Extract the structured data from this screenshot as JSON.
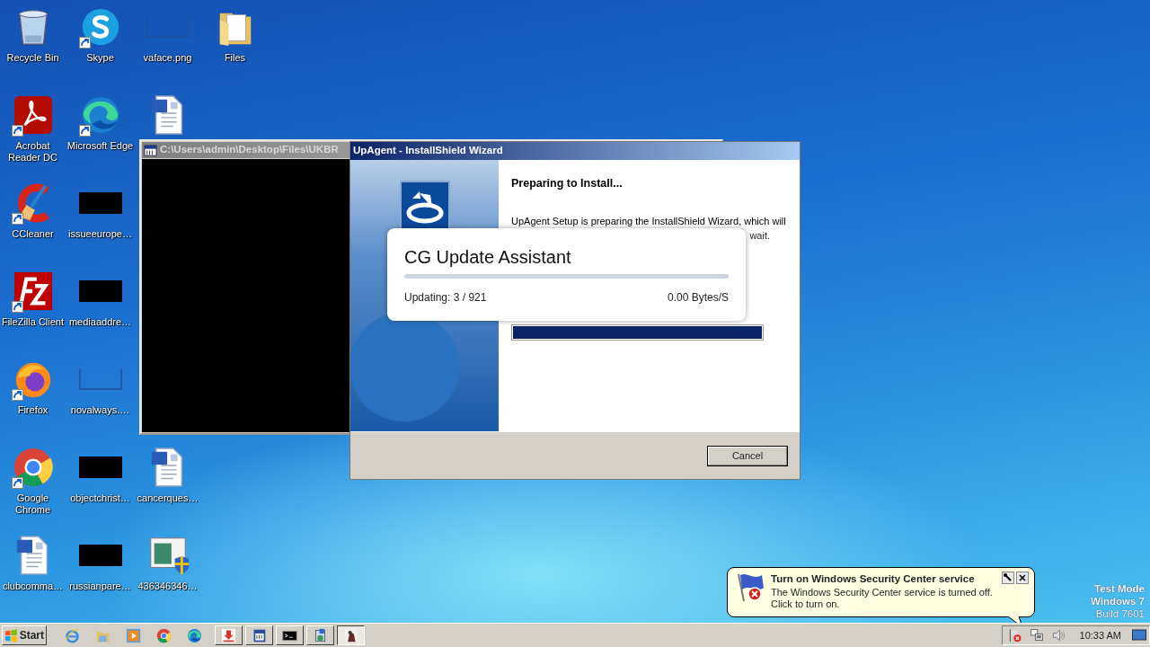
{
  "desktop_icons": [
    {
      "label": "Recycle Bin",
      "kind": "recycle-bin",
      "shortcut": false
    },
    {
      "label": "Acrobat Reader DC",
      "kind": "pdf",
      "shortcut": true
    },
    {
      "label": "CCleaner",
      "kind": "cleaner",
      "shortcut": true
    },
    {
      "label": "FileZilla Client",
      "kind": "filezilla",
      "shortcut": true
    },
    {
      "label": "Firefox",
      "kind": "firefox",
      "shortcut": true
    },
    {
      "label": "Google Chrome",
      "kind": "chrome",
      "shortcut": true
    },
    {
      "label": "clubcomma…",
      "kind": "word",
      "shortcut": false
    },
    {
      "label": "Skype",
      "kind": "skype",
      "shortcut": true
    },
    {
      "label": "Microsoft Edge",
      "kind": "edge",
      "shortcut": true
    },
    {
      "label": "issueeurope…",
      "kind": "black-thumb",
      "shortcut": false
    },
    {
      "label": "mediaaddre…",
      "kind": "black-thumb",
      "shortcut": false
    },
    {
      "label": "novalways.…",
      "kind": "blank-thumb",
      "shortcut": false
    },
    {
      "label": "objectchrist…",
      "kind": "black-thumb",
      "shortcut": false
    },
    {
      "label": "russianpare…",
      "kind": "black-thumb",
      "shortcut": false
    },
    {
      "label": "vaface.png",
      "kind": "blank-thumb",
      "shortcut": false
    },
    {
      "kind": "word",
      "shortcut": false
    },
    {
      "label": "cancerques…",
      "kind": "word",
      "shortcut": false
    },
    {
      "label": "436346346…",
      "kind": "installer",
      "shortcut": false
    },
    {
      "label": "Files",
      "kind": "folder",
      "shortcut": false
    }
  ],
  "console_window": {
    "title": "C:\\Users\\admin\\Desktop\\Files\\UKBR"
  },
  "wizard": {
    "title": "UpAgent - InstallShield Wizard",
    "heading": "Preparing to Install...",
    "body_lines": [
      "UpAgent Setup is preparing the InstallShield Wizard, which will",
      "wait."
    ],
    "progress": {
      "level": 1
    },
    "cancel_button": "Cancel"
  },
  "update_popup": {
    "title": "CG Update Assistant",
    "progress": {
      "level": 0
    },
    "status": "Updating: 3 / 921",
    "speed": "0.00 Bytes/S"
  },
  "balloon": {
    "title": "Turn on Windows Security Center service",
    "message": "The Windows Security Center service is turned off. Click to turn on."
  },
  "test_mode_text": [
    {
      "text": "Test Mode",
      "bold": true
    },
    {
      "text": "Windows 7",
      "bold": true
    },
    {
      "text": "Build 7601",
      "bold": false
    }
  ],
  "taskbar": {
    "start_label": "Start",
    "quick_launch": [
      {
        "kind": "ie"
      },
      {
        "kind": "explorer"
      },
      {
        "kind": "media"
      },
      {
        "kind": "chrome"
      },
      {
        "kind": "edge"
      }
    ],
    "tasks": [
      {
        "kind": "download",
        "selected": false
      },
      {
        "kind": "window",
        "selected": false
      },
      {
        "kind": "cmd",
        "selected": false
      },
      {
        "kind": "setup",
        "selected": false
      },
      {
        "kind": "wizard",
        "selected": true
      }
    ],
    "tray": {
      "icons": [
        {
          "kind": "flag-error"
        },
        {
          "kind": "network"
        },
        {
          "kind": "volume"
        }
      ],
      "clock": "10:33 AM"
    }
  }
}
